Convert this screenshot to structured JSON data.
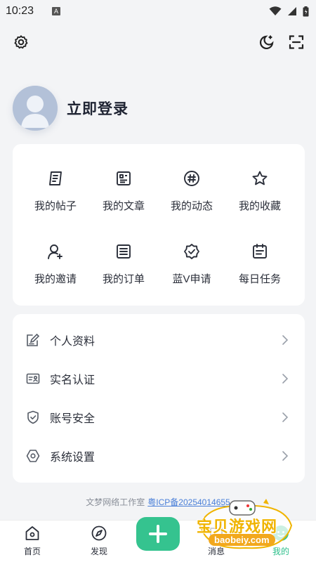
{
  "status_bar": {
    "time": "10:23",
    "notif": "A"
  },
  "profile": {
    "login_label": "立即登录"
  },
  "grid": {
    "items": [
      {
        "label": "我的帖子",
        "icon": "post-icon"
      },
      {
        "label": "我的文章",
        "icon": "article-icon"
      },
      {
        "label": "我的动态",
        "icon": "hashtag-icon"
      },
      {
        "label": "我的收藏",
        "icon": "star-icon"
      },
      {
        "label": "我的邀请",
        "icon": "invite-user-icon"
      },
      {
        "label": "我的订单",
        "icon": "order-icon"
      },
      {
        "label": "蓝V申请",
        "icon": "verified-badge-icon"
      },
      {
        "label": "每日任务",
        "icon": "calendar-task-icon"
      }
    ]
  },
  "menu": {
    "items": [
      {
        "label": "个人资料",
        "icon": "edit-profile-icon"
      },
      {
        "label": "实名认证",
        "icon": "id-card-icon"
      },
      {
        "label": "账号安全",
        "icon": "shield-icon"
      },
      {
        "label": "系统设置",
        "icon": "settings-hex-icon"
      }
    ]
  },
  "footer": {
    "studio": "文梦网络工作室",
    "icp": "粤ICP备20254014655"
  },
  "tabbar": {
    "tabs": [
      {
        "label": "首页",
        "icon": "home-icon"
      },
      {
        "label": "发现",
        "icon": "compass-icon"
      },
      {
        "label": "消息",
        "icon": "message-icon"
      },
      {
        "label": "我的",
        "icon": "profile-icon"
      }
    ],
    "active": "我的"
  },
  "watermark": {
    "text": "宝贝游戏网",
    "url": "baobeiy.com"
  },
  "colors": {
    "accent": "#35c38f",
    "background": "#f3f4f6",
    "icp_link": "#4a7fd8"
  }
}
